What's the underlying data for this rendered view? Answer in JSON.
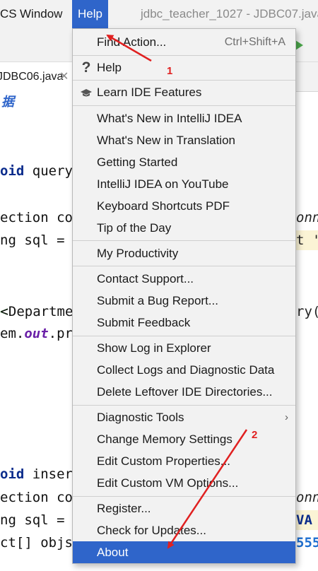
{
  "menubar": {
    "items": [
      "CS",
      "Window",
      "Help"
    ],
    "title": "jdbc_teacher_1027 - JDBC07.java"
  },
  "tab": {
    "label": "JDBC06.java",
    "close": "✕"
  },
  "code": {
    "comment": "据",
    "lines": [
      {
        "kw": "oid",
        "rest": " query"
      },
      {
        "text": "ection co"
      },
      {
        "text": "ng sql = "
      },
      {
        "text": "<Departme",
        "right": "ry("
      },
      {
        "text": "em.",
        "italic": "out",
        "after": ".pr"
      },
      {
        "kw": "oid",
        "rest": " inser"
      },
      {
        "text": "ection co"
      },
      {
        "text": "ng sql = ",
        "right": "VA"
      },
      {
        "text": "ct[] objs",
        "right": "555"
      }
    ],
    "right_frags": [
      "onn",
      "t '",
      "onn"
    ]
  },
  "menu": {
    "groups": [
      [
        {
          "label": "Find Action...",
          "shortcut": "Ctrl+Shift+A"
        }
      ],
      [
        {
          "label": "Help",
          "icon": "question-icon"
        }
      ],
      [
        {
          "label": "Learn IDE Features",
          "icon": "graduation-cap-icon"
        }
      ],
      [
        {
          "label": "What's New in IntelliJ IDEA"
        },
        {
          "label": "What's New in Translation"
        },
        {
          "label": "Getting Started"
        },
        {
          "label": "IntelliJ IDEA on YouTube"
        },
        {
          "label": "Keyboard Shortcuts PDF"
        },
        {
          "label": "Tip of the Day"
        }
      ],
      [
        {
          "label": "My Productivity"
        }
      ],
      [
        {
          "label": "Contact Support..."
        },
        {
          "label": "Submit a Bug Report..."
        },
        {
          "label": "Submit Feedback"
        }
      ],
      [
        {
          "label": "Show Log in Explorer"
        },
        {
          "label": "Collect Logs and Diagnostic Data"
        },
        {
          "label": "Delete Leftover IDE Directories..."
        }
      ],
      [
        {
          "label": "Diagnostic Tools",
          "submenu": "›"
        },
        {
          "label": "Change Memory Settings"
        },
        {
          "label": "Edit Custom Properties..."
        },
        {
          "label": "Edit Custom VM Options..."
        }
      ],
      [
        {
          "label": "Register..."
        },
        {
          "label": "Check for Updates..."
        },
        {
          "label": "About",
          "active": true
        }
      ]
    ]
  },
  "annotations": {
    "step1": "1",
    "step2": "2"
  },
  "colors": {
    "accent": "#2f65ca",
    "annotation": "#e02020",
    "menu_bg": "#f2f2f2"
  }
}
